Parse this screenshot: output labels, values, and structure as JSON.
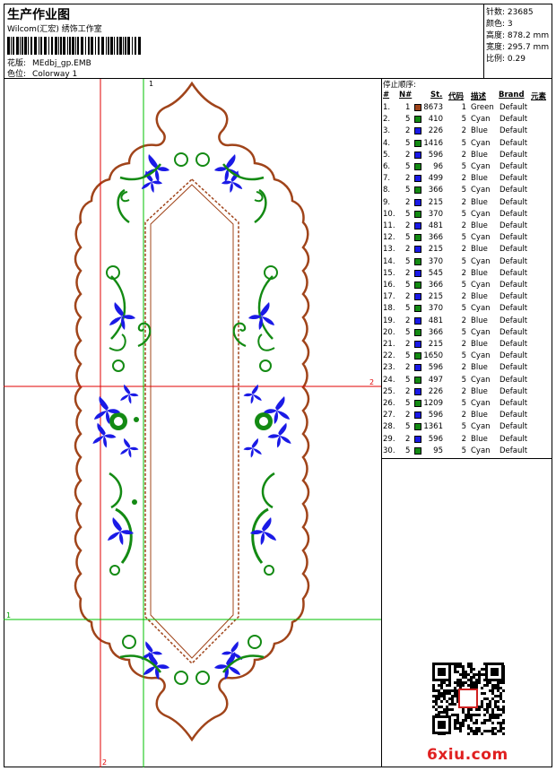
{
  "header": {
    "title": "生产作业图",
    "company": "Wilcom(汇宏) 绣饰工作室",
    "design_label": "花版:",
    "design_value": "MEdbj_gp.EMB",
    "colorway_label": "色位:",
    "colorway_value": "Colorway 1"
  },
  "stats": [
    {
      "label": "针数:",
      "value": "23685"
    },
    {
      "label": "颜色:",
      "value": "3"
    },
    {
      "label": "高度:",
      "value": "878.2 mm"
    },
    {
      "label": "宽度:",
      "value": "295.7 mm"
    },
    {
      "label": "比例:",
      "value": "0.29"
    }
  ],
  "guides": {
    "v1": "1",
    "h2": "2",
    "h1": "1",
    "v2": "2"
  },
  "stop_sequence": {
    "title": "停止顺序:",
    "headers": [
      "#",
      "N#",
      "St.",
      "代码",
      "描述",
      "Brand",
      "元素"
    ],
    "rows": [
      {
        "n": "1.",
        "nn": "1",
        "st": "8673",
        "code": "1",
        "desc": "Green",
        "brand": "Default",
        "color": "#a0441a"
      },
      {
        "n": "2.",
        "nn": "5",
        "st": "410",
        "code": "5",
        "desc": "Cyan",
        "brand": "Default",
        "color": "#138a13"
      },
      {
        "n": "3.",
        "nn": "2",
        "st": "226",
        "code": "2",
        "desc": "Blue",
        "brand": "Default",
        "color": "#1a1ae6"
      },
      {
        "n": "4.",
        "nn": "5",
        "st": "1416",
        "code": "5",
        "desc": "Cyan",
        "brand": "Default",
        "color": "#138a13"
      },
      {
        "n": "5.",
        "nn": "2",
        "st": "596",
        "code": "2",
        "desc": "Blue",
        "brand": "Default",
        "color": "#1a1ae6"
      },
      {
        "n": "6.",
        "nn": "5",
        "st": "96",
        "code": "5",
        "desc": "Cyan",
        "brand": "Default",
        "color": "#138a13"
      },
      {
        "n": "7.",
        "nn": "2",
        "st": "499",
        "code": "2",
        "desc": "Blue",
        "brand": "Default",
        "color": "#1a1ae6"
      },
      {
        "n": "8.",
        "nn": "5",
        "st": "366",
        "code": "5",
        "desc": "Cyan",
        "brand": "Default",
        "color": "#138a13"
      },
      {
        "n": "9.",
        "nn": "2",
        "st": "215",
        "code": "2",
        "desc": "Blue",
        "brand": "Default",
        "color": "#1a1ae6"
      },
      {
        "n": "10.",
        "nn": "5",
        "st": "370",
        "code": "5",
        "desc": "Cyan",
        "brand": "Default",
        "color": "#138a13"
      },
      {
        "n": "11.",
        "nn": "2",
        "st": "481",
        "code": "2",
        "desc": "Blue",
        "brand": "Default",
        "color": "#1a1ae6"
      },
      {
        "n": "12.",
        "nn": "5",
        "st": "366",
        "code": "5",
        "desc": "Cyan",
        "brand": "Default",
        "color": "#138a13"
      },
      {
        "n": "13.",
        "nn": "2",
        "st": "215",
        "code": "2",
        "desc": "Blue",
        "brand": "Default",
        "color": "#1a1ae6"
      },
      {
        "n": "14.",
        "nn": "5",
        "st": "370",
        "code": "5",
        "desc": "Cyan",
        "brand": "Default",
        "color": "#138a13"
      },
      {
        "n": "15.",
        "nn": "2",
        "st": "545",
        "code": "2",
        "desc": "Blue",
        "brand": "Default",
        "color": "#1a1ae6"
      },
      {
        "n": "16.",
        "nn": "5",
        "st": "366",
        "code": "5",
        "desc": "Cyan",
        "brand": "Default",
        "color": "#138a13"
      },
      {
        "n": "17.",
        "nn": "2",
        "st": "215",
        "code": "2",
        "desc": "Blue",
        "brand": "Default",
        "color": "#1a1ae6"
      },
      {
        "n": "18.",
        "nn": "5",
        "st": "370",
        "code": "5",
        "desc": "Cyan",
        "brand": "Default",
        "color": "#138a13"
      },
      {
        "n": "19.",
        "nn": "2",
        "st": "481",
        "code": "2",
        "desc": "Blue",
        "brand": "Default",
        "color": "#1a1ae6"
      },
      {
        "n": "20.",
        "nn": "5",
        "st": "366",
        "code": "5",
        "desc": "Cyan",
        "brand": "Default",
        "color": "#138a13"
      },
      {
        "n": "21.",
        "nn": "2",
        "st": "215",
        "code": "2",
        "desc": "Blue",
        "brand": "Default",
        "color": "#1a1ae6"
      },
      {
        "n": "22.",
        "nn": "5",
        "st": "1650",
        "code": "5",
        "desc": "Cyan",
        "brand": "Default",
        "color": "#138a13"
      },
      {
        "n": "23.",
        "nn": "2",
        "st": "596",
        "code": "2",
        "desc": "Blue",
        "brand": "Default",
        "color": "#1a1ae6"
      },
      {
        "n": "24.",
        "nn": "5",
        "st": "497",
        "code": "5",
        "desc": "Cyan",
        "brand": "Default",
        "color": "#138a13"
      },
      {
        "n": "25.",
        "nn": "2",
        "st": "226",
        "code": "2",
        "desc": "Blue",
        "brand": "Default",
        "color": "#1a1ae6"
      },
      {
        "n": "26.",
        "nn": "5",
        "st": "1209",
        "code": "5",
        "desc": "Cyan",
        "brand": "Default",
        "color": "#138a13"
      },
      {
        "n": "27.",
        "nn": "2",
        "st": "596",
        "code": "2",
        "desc": "Blue",
        "brand": "Default",
        "color": "#1a1ae6"
      },
      {
        "n": "28.",
        "nn": "5",
        "st": "1361",
        "code": "5",
        "desc": "Cyan",
        "brand": "Default",
        "color": "#138a13"
      },
      {
        "n": "29.",
        "nn": "2",
        "st": "596",
        "code": "2",
        "desc": "Blue",
        "brand": "Default",
        "color": "#1a1ae6"
      },
      {
        "n": "30.",
        "nn": "5",
        "st": "95",
        "code": "5",
        "desc": "Cyan",
        "brand": "Default",
        "color": "#138a13"
      }
    ]
  },
  "colors": {
    "outline": "#a0441a",
    "green": "#138a13",
    "blue": "#1a1ae6",
    "guide_red": "#e00000",
    "guide_green": "#00c000"
  },
  "watermark": "6xiu.com"
}
